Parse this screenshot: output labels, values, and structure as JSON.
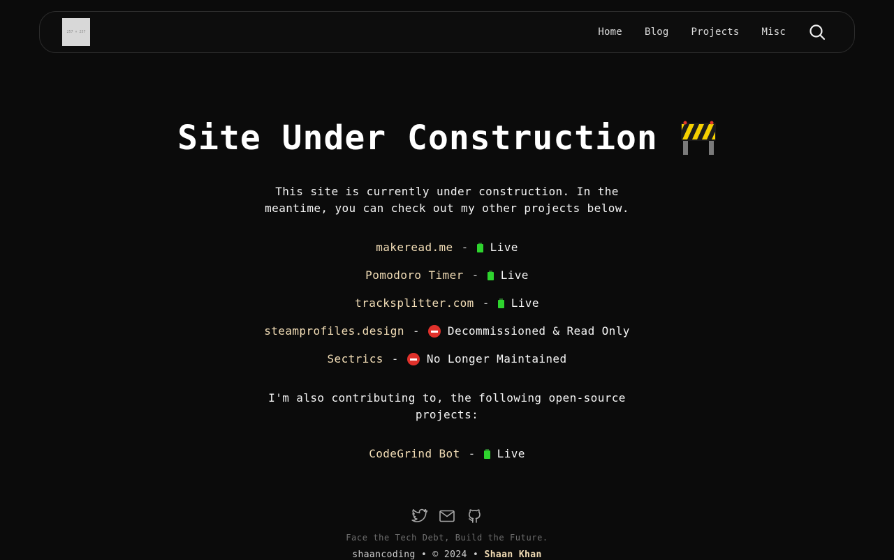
{
  "header": {
    "logo_text": "257 × 257",
    "nav": [
      "Home",
      "Blog",
      "Projects",
      "Misc"
    ]
  },
  "main": {
    "title": "Site Under Construction",
    "intro": "This site is currently under construction. In the meantime, you can check out my other projects below.",
    "projects": [
      {
        "name": "makeread.me",
        "separator": "-",
        "status": "Live",
        "status_icon": "battery-icon"
      },
      {
        "name": "Pomodoro Timer",
        "separator": "-",
        "status": "Live",
        "status_icon": "battery-icon"
      },
      {
        "name": "tracksplitter.com",
        "separator": "-",
        "status": "Live",
        "status_icon": "battery-icon"
      },
      {
        "name": "steamprofiles.design",
        "separator": "-",
        "status": "Decommissioned & Read Only",
        "status_icon": "no-entry-icon"
      },
      {
        "name": "Sectrics",
        "separator": "-",
        "status": "No Longer Maintained",
        "status_icon": "no-entry-icon"
      }
    ],
    "contrib_text": "I'm also contributing to, the following open-source projects:",
    "open_source": [
      {
        "name": "CodeGrind Bot",
        "separator": "-",
        "status": "Live",
        "status_icon": "battery-icon"
      }
    ]
  },
  "footer": {
    "social": [
      "twitter-icon",
      "mail-icon",
      "github-icon"
    ],
    "tagline": "Face the Tech Debt, Build the Future.",
    "copyright_prefix": "shaancoding • © 2024 •",
    "author": "Shaan Khan"
  },
  "colors": {
    "background": "#0b0b0b",
    "link": "#f2ddb6",
    "live": "#2ed42e",
    "decommissioned": "#e0312b"
  }
}
